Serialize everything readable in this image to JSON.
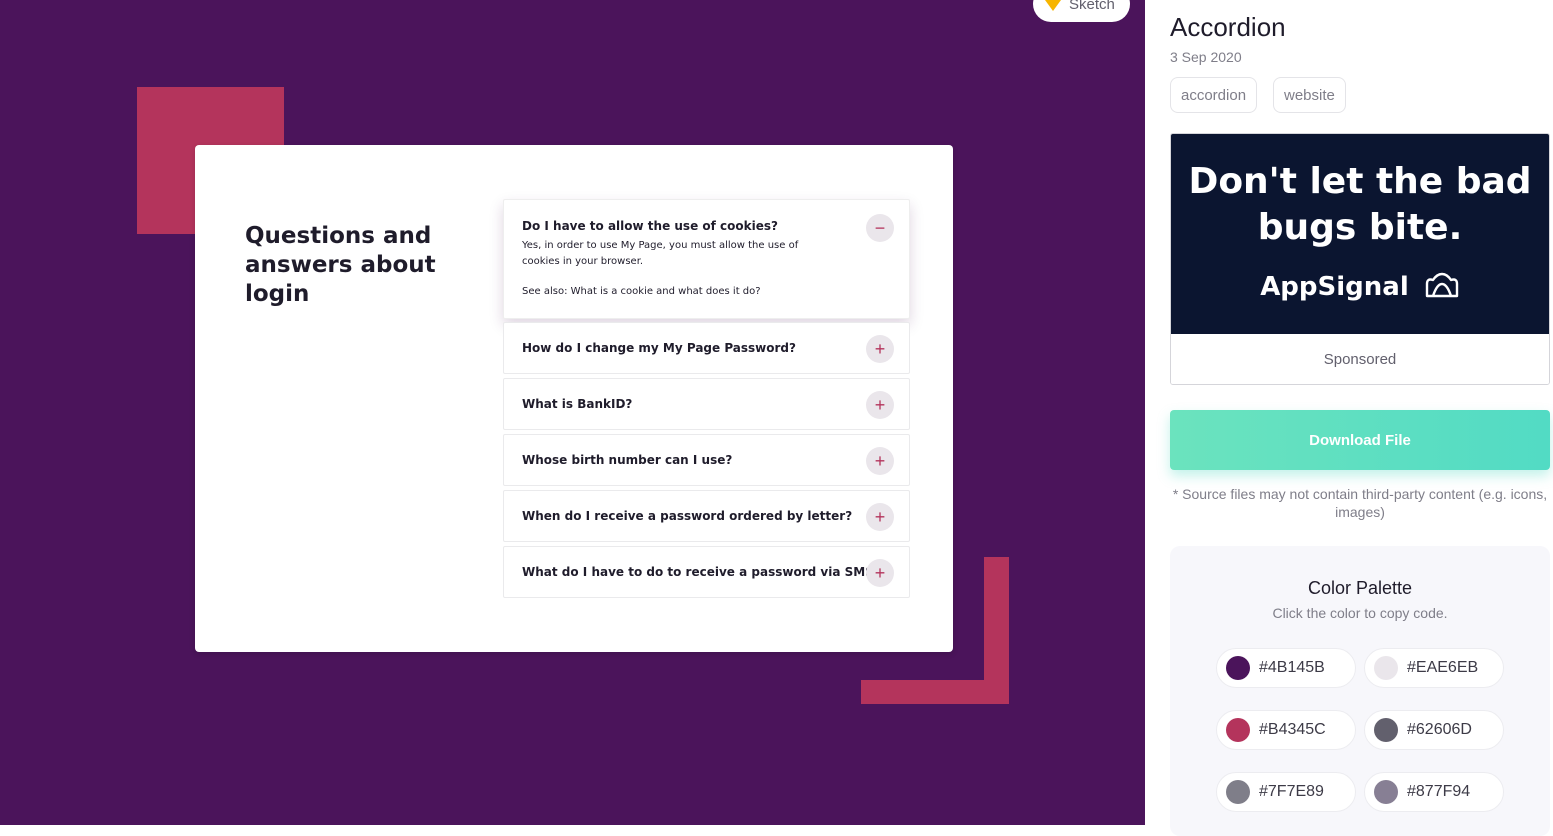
{
  "preview": {
    "sketch_badge": "Sketch",
    "card_title": "Questions and answers about login",
    "accordion": [
      {
        "question": "Do I have to allow the use of cookies?",
        "answer": "Yes, in order to use My Page, you must allow the use of cookies in your browser.",
        "see_also": "See also: What is a cookie and what does it do?",
        "toggle": "−",
        "open": true
      },
      {
        "question": "How do I change my My Page Password?",
        "toggle": "+"
      },
      {
        "question": "What is BankID?",
        "toggle": "+"
      },
      {
        "question": "Whose birth number can I use?",
        "toggle": "+"
      },
      {
        "question": "When do I receive a password ordered by letter?",
        "toggle": "+"
      },
      {
        "question": "What do I have to do to receive a password via SMS?",
        "toggle": "+"
      }
    ]
  },
  "sidebar": {
    "title": "Accordion",
    "date": "3 Sep 2020",
    "tags": [
      "accordion",
      "website"
    ],
    "ad": {
      "headline": "Don't let the bad bugs bite.",
      "brand": "AppSignal",
      "sponsored": "Sponsored"
    },
    "download_label": "Download File",
    "note": "* Source files may not contain third-party content (e.g. icons, images)",
    "palette": {
      "title": "Color Palette",
      "subtitle": "Click the color to copy code.",
      "colors": [
        "#4B145B",
        "#EAE6EB",
        "#B4345C",
        "#62606D",
        "#7F7E89",
        "#877F94"
      ]
    }
  },
  "colors": {
    "preview_bg": "#4b145b",
    "accent": "#b4345c",
    "download_gradient": [
      "#6be3be",
      "#52dbc4"
    ],
    "ad_bg": "#0b1530"
  }
}
